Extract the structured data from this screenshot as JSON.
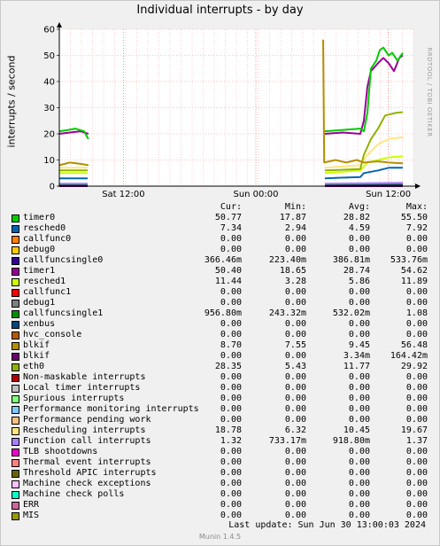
{
  "title": "Individual interrupts - by day",
  "vertical_label": "interrupts / second",
  "watermark": "RRDTOOL / TOBI OETIKER",
  "columns": {
    "cur": "Cur:",
    "min": "Min:",
    "avg": "Avg:",
    "max": "Max:"
  },
  "chart_data": {
    "type": "line",
    "title": "Individual interrupts - by day",
    "ylabel": "interrupts / second",
    "xlabel": "",
    "ylim": [
      0,
      60
    ],
    "yticks": [
      0,
      10,
      20,
      30,
      40,
      50,
      60
    ],
    "x_ticks": [
      {
        "label": "Sat 12:00",
        "frac": 0.181
      },
      {
        "label": "Sun 00:00",
        "frac": 0.555
      },
      {
        "label": "Sun 12:00",
        "frac": 0.929
      }
    ],
    "grid": true,
    "legend_position": "bottom",
    "series": [
      {
        "name": "timer0",
        "color": "#00cc00",
        "cur": "50.77",
        "min": "17.87",
        "avg": "28.82",
        "max": "55.50",
        "points": [
          [
            0,
            21
          ],
          [
            0.025,
            21.5
          ],
          [
            0.045,
            22
          ],
          [
            0.07,
            21
          ],
          [
            0.082,
            18
          ],
          [
            null,
            null
          ],
          [
            0.75,
            21
          ],
          [
            0.8,
            21.5
          ],
          [
            0.85,
            22
          ],
          [
            0.86,
            21
          ],
          [
            0.87,
            28
          ],
          [
            0.88,
            45
          ],
          [
            0.895,
            48
          ],
          [
            0.905,
            52
          ],
          [
            0.915,
            53
          ],
          [
            0.93,
            50
          ],
          [
            0.94,
            51
          ],
          [
            0.955,
            48
          ],
          [
            0.97,
            51
          ]
        ]
      },
      {
        "name": "resched0",
        "color": "#0066b3",
        "cur": "7.34",
        "min": "2.94",
        "avg": "4.59",
        "max": "7.92",
        "points": [
          [
            0,
            3
          ],
          [
            0.08,
            3
          ],
          [
            null,
            null
          ],
          [
            0.75,
            3
          ],
          [
            0.85,
            3.5
          ],
          [
            0.86,
            5
          ],
          [
            0.9,
            6
          ],
          [
            0.93,
            7
          ],
          [
            0.97,
            7
          ]
        ]
      },
      {
        "name": "callfunc0",
        "color": "#ff8000",
        "cur": "0.00",
        "min": "0.00",
        "avg": "0.00",
        "max": "0.00",
        "points": [
          [
            0,
            0
          ],
          [
            0.08,
            0
          ],
          [
            null,
            null
          ],
          [
            0.75,
            0
          ],
          [
            0.97,
            0
          ]
        ]
      },
      {
        "name": "debug0",
        "color": "#ffcc00",
        "cur": "0.00",
        "min": "0.00",
        "avg": "0.00",
        "max": "0.00",
        "points": [
          [
            0,
            0
          ],
          [
            0.08,
            0
          ],
          [
            null,
            null
          ],
          [
            0.75,
            0
          ],
          [
            0.97,
            0
          ]
        ]
      },
      {
        "name": "callfuncsingle0",
        "color": "#330099",
        "cur": "366.46m",
        "min": "223.40m",
        "avg": "386.81m",
        "max": "533.76m",
        "points": [
          [
            0,
            0.4
          ],
          [
            0.08,
            0.4
          ],
          [
            null,
            null
          ],
          [
            0.75,
            0.4
          ],
          [
            0.97,
            0.4
          ]
        ]
      },
      {
        "name": "timer1",
        "color": "#990099",
        "cur": "50.40",
        "min": "18.65",
        "avg": "28.74",
        "max": "54.62",
        "points": [
          [
            0,
            20
          ],
          [
            0.03,
            20.5
          ],
          [
            0.06,
            21
          ],
          [
            0.082,
            20
          ],
          [
            null,
            null
          ],
          [
            0.75,
            20
          ],
          [
            0.8,
            20.5
          ],
          [
            0.85,
            20
          ],
          [
            0.86,
            25
          ],
          [
            0.87,
            38
          ],
          [
            0.88,
            44
          ],
          [
            0.9,
            47
          ],
          [
            0.915,
            49
          ],
          [
            0.93,
            47
          ],
          [
            0.945,
            44
          ],
          [
            0.96,
            49
          ],
          [
            0.97,
            50
          ]
        ]
      },
      {
        "name": "resched1",
        "color": "#ccff00",
        "cur": "11.44",
        "min": "3.28",
        "avg": "5.86",
        "max": "11.89",
        "points": [
          [
            0,
            5
          ],
          [
            0.08,
            5
          ],
          [
            null,
            null
          ],
          [
            0.75,
            5
          ],
          [
            0.85,
            6
          ],
          [
            0.87,
            9
          ],
          [
            0.93,
            11
          ],
          [
            0.97,
            11.4
          ]
        ]
      },
      {
        "name": "callfunc1",
        "color": "#ff0000",
        "cur": "0.00",
        "min": "0.00",
        "avg": "0.00",
        "max": "0.00",
        "points": [
          [
            0,
            0
          ],
          [
            0.08,
            0
          ],
          [
            null,
            null
          ],
          [
            0.75,
            0
          ],
          [
            0.97,
            0
          ]
        ]
      },
      {
        "name": "debug1",
        "color": "#808080",
        "cur": "0.00",
        "min": "0.00",
        "avg": "0.00",
        "max": "0.00",
        "points": [
          [
            0,
            0
          ],
          [
            0.08,
            0
          ],
          [
            null,
            null
          ],
          [
            0.75,
            0
          ],
          [
            0.97,
            0
          ]
        ]
      },
      {
        "name": "callfuncsingle1",
        "color": "#008f00",
        "cur": "956.80m",
        "min": "243.32m",
        "avg": "532.02m",
        "max": "1.08",
        "points": [
          [
            0,
            0.8
          ],
          [
            0.08,
            0.8
          ],
          [
            null,
            null
          ],
          [
            0.75,
            0.8
          ],
          [
            0.97,
            0.9
          ]
        ]
      },
      {
        "name": "xenbus",
        "color": "#00487d",
        "cur": "0.00",
        "min": "0.00",
        "avg": "0.00",
        "max": "0.00",
        "points": [
          [
            0,
            0
          ],
          [
            0.08,
            0
          ],
          [
            null,
            null
          ],
          [
            0.75,
            0
          ],
          [
            0.97,
            0
          ]
        ]
      },
      {
        "name": "hvc_console",
        "color": "#b35a00",
        "cur": "0.00",
        "min": "0.00",
        "avg": "0.00",
        "max": "0.00",
        "points": [
          [
            0,
            0
          ],
          [
            0.08,
            0
          ],
          [
            null,
            null
          ],
          [
            0.75,
            0
          ],
          [
            0.97,
            0
          ]
        ]
      },
      {
        "name": "blkif",
        "color": "#b38f00",
        "cur": "8.70",
        "min": "7.55",
        "avg": "9.45",
        "max": "56.48",
        "points": [
          [
            0,
            8
          ],
          [
            0.03,
            9
          ],
          [
            0.06,
            8.5
          ],
          [
            0.082,
            8
          ],
          [
            null,
            null
          ],
          [
            0.745,
            56
          ],
          [
            0.748,
            9
          ],
          [
            0.78,
            10
          ],
          [
            0.81,
            9
          ],
          [
            0.84,
            10
          ],
          [
            0.86,
            9
          ],
          [
            0.9,
            9.5
          ],
          [
            0.93,
            9
          ],
          [
            0.97,
            8.7
          ]
        ]
      },
      {
        "name": "blkif",
        "color": "#6b006b",
        "cur": "0.00",
        "min": "0.00",
        "avg": "3.34m",
        "max": "164.42m",
        "points": [
          [
            0,
            0
          ],
          [
            0.08,
            0
          ],
          [
            null,
            null
          ],
          [
            0.75,
            0
          ],
          [
            0.97,
            0
          ]
        ]
      },
      {
        "name": "eth0",
        "color": "#8fb300",
        "cur": "28.35",
        "min": "5.43",
        "avg": "11.77",
        "max": "29.92",
        "points": [
          [
            0,
            6
          ],
          [
            0.08,
            6
          ],
          [
            null,
            null
          ],
          [
            0.75,
            6
          ],
          [
            0.85,
            6.5
          ],
          [
            0.86,
            12
          ],
          [
            0.88,
            18
          ],
          [
            0.9,
            22
          ],
          [
            0.92,
            27
          ],
          [
            0.95,
            28
          ],
          [
            0.97,
            28.3
          ]
        ]
      },
      {
        "name": "Non-maskable interrupts",
        "color": "#b30000",
        "cur": "0.00",
        "min": "0.00",
        "avg": "0.00",
        "max": "0.00",
        "points": []
      },
      {
        "name": "Local timer interrupts",
        "color": "#bebebe",
        "cur": "0.00",
        "min": "0.00",
        "avg": "0.00",
        "max": "0.00",
        "points": []
      },
      {
        "name": "Spurious interrupts",
        "color": "#80ff80",
        "cur": "0.00",
        "min": "0.00",
        "avg": "0.00",
        "max": "0.00",
        "points": []
      },
      {
        "name": "Performance monitoring interrupts",
        "color": "#80c9ff",
        "cur": "0.00",
        "min": "0.00",
        "avg": "0.00",
        "max": "0.00",
        "points": []
      },
      {
        "name": "Performance pending work",
        "color": "#ffc080",
        "cur": "0.00",
        "min": "0.00",
        "avg": "0.00",
        "max": "0.00",
        "points": []
      },
      {
        "name": "Rescheduling interrupts",
        "color": "#ffe680",
        "cur": "18.78",
        "min": "6.32",
        "avg": "10.45",
        "max": "19.67",
        "points": [
          [
            0,
            7
          ],
          [
            0.08,
            7
          ],
          [
            null,
            null
          ],
          [
            0.75,
            7
          ],
          [
            0.85,
            8
          ],
          [
            0.87,
            12
          ],
          [
            0.9,
            16
          ],
          [
            0.93,
            18
          ],
          [
            0.97,
            18.7
          ]
        ]
      },
      {
        "name": "Function call interrupts",
        "color": "#aa80ff",
        "cur": "1.32",
        "min": "733.17m",
        "avg": "918.80m",
        "max": "1.37",
        "points": [
          [
            0,
            1
          ],
          [
            0.08,
            1
          ],
          [
            null,
            null
          ],
          [
            0.75,
            1
          ],
          [
            0.97,
            1.3
          ]
        ]
      },
      {
        "name": "TLB shootdowns",
        "color": "#ee00cc",
        "cur": "0.00",
        "min": "0.00",
        "avg": "0.00",
        "max": "0.00",
        "points": []
      },
      {
        "name": "Thermal event interrupts",
        "color": "#ff8080",
        "cur": "0.00",
        "min": "0.00",
        "avg": "0.00",
        "max": "0.00",
        "points": []
      },
      {
        "name": "Threshold APIC interrupts",
        "color": "#666600",
        "cur": "0.00",
        "min": "0.00",
        "avg": "0.00",
        "max": "0.00",
        "points": []
      },
      {
        "name": "Machine check exceptions",
        "color": "#ffbfff",
        "cur": "0.00",
        "min": "0.00",
        "avg": "0.00",
        "max": "0.00",
        "points": []
      },
      {
        "name": "Machine check polls",
        "color": "#00ffcc",
        "cur": "0.00",
        "min": "0.00",
        "avg": "0.00",
        "max": "0.00",
        "points": []
      },
      {
        "name": "ERR",
        "color": "#cc6699",
        "cur": "0.00",
        "min": "0.00",
        "avg": "0.00",
        "max": "0.00",
        "points": []
      },
      {
        "name": "MIS",
        "color": "#999900",
        "cur": "0.00",
        "min": "0.00",
        "avg": "0.00",
        "max": "0.00",
        "points": []
      }
    ]
  },
  "last_update": "Last update:  Sun Jun 30 13:00:03 2024",
  "version": "Munin 1.4.5"
}
